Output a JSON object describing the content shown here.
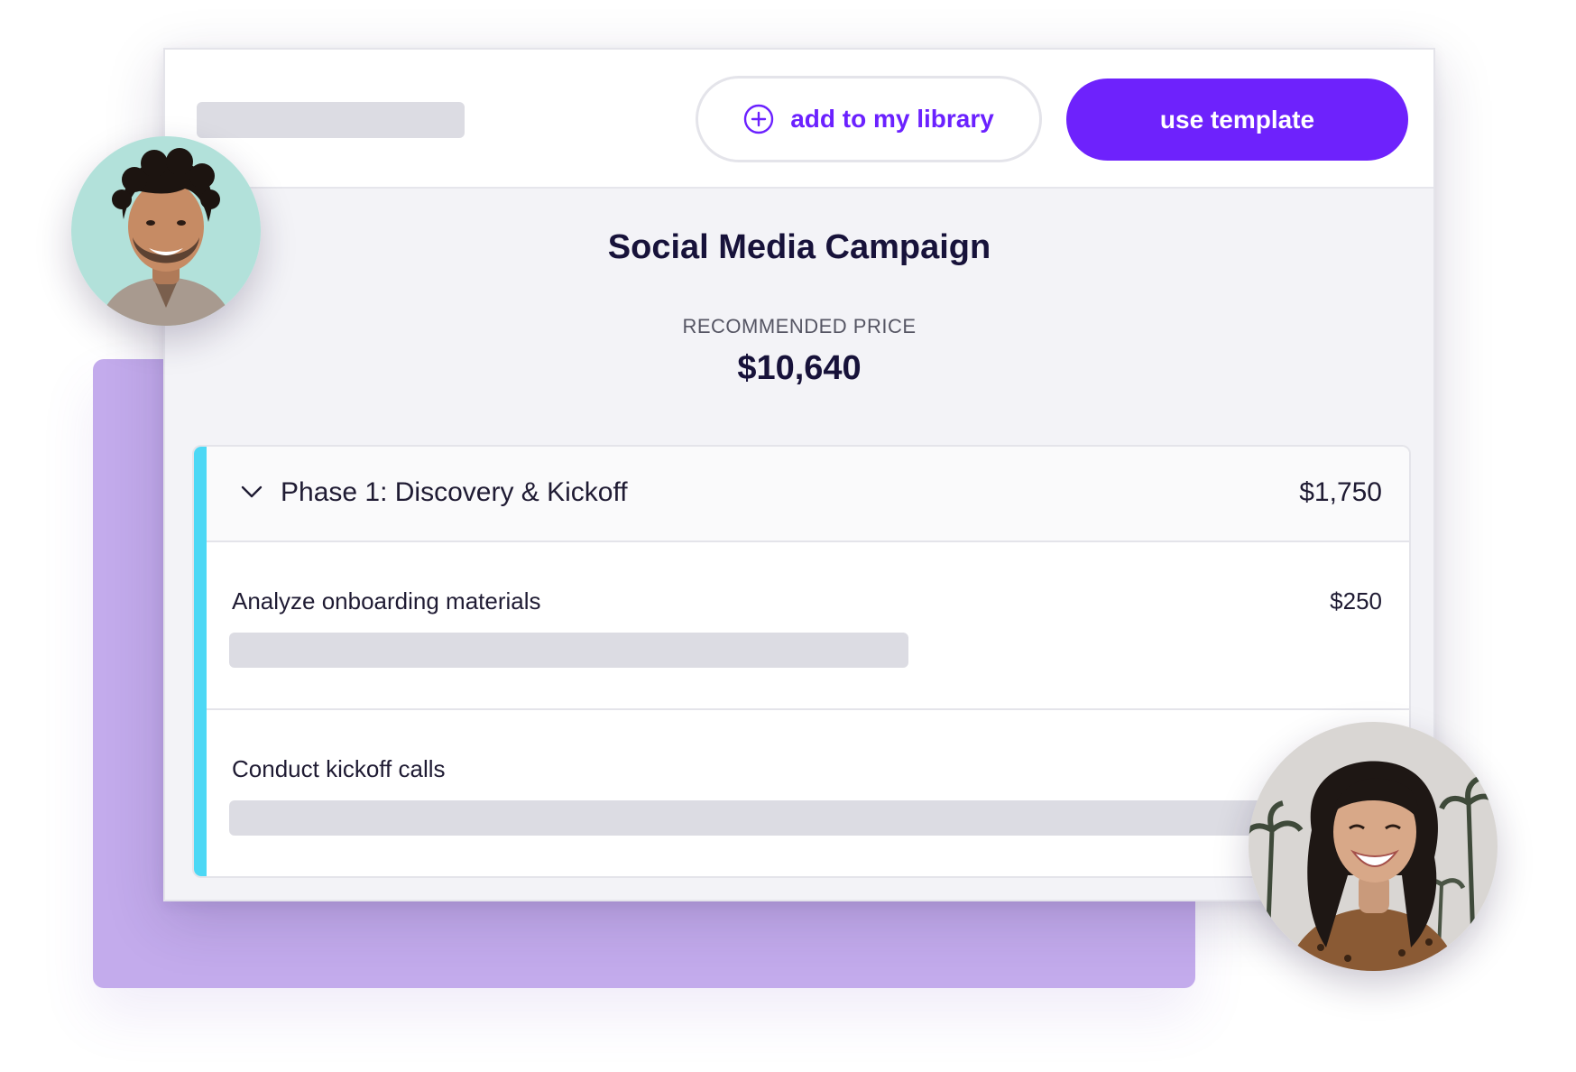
{
  "toolbar": {
    "add_to_library_label": "add to my library",
    "use_template_label": "use template"
  },
  "template": {
    "title": "Social Media Campaign",
    "price_label": "RECOMMENDED PRICE",
    "price_value": "$10,640"
  },
  "phase": {
    "title": "Phase 1: Discovery & Kickoff",
    "price": "$1,750",
    "tasks": [
      {
        "name": "Analyze onboarding materials",
        "price": "$250"
      },
      {
        "name": "Conduct kickoff calls",
        "price": ""
      }
    ]
  },
  "colors": {
    "accent": "#6e22fc",
    "phase_bar": "#4cd8f5",
    "backdrop": "#c3abec"
  },
  "icons": [
    "plus-circle-icon",
    "chevron-down-icon"
  ]
}
